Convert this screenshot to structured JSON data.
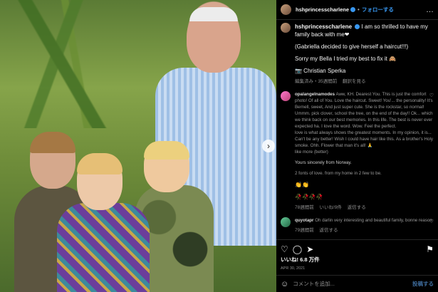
{
  "header": {
    "username": "hshprincesscharlene",
    "separator": "•",
    "follow_label": "フォローする",
    "more": "…"
  },
  "caption": {
    "username": "hshprincesscharlene",
    "line1": "I am so thrilled to have my family back with me❤",
    "line2": "(Gabriella decided to give herself a haircut!!!)",
    "line3": "Sorry my Bella I tried my best to fix it 🙈",
    "credit": "📷 Christian Sperka",
    "meta_time": "編集済み・35週間前",
    "meta_translate": "翻訳を見る"
  },
  "comments": [
    {
      "username": "opalangelnamodes",
      "text": "Aww, KH. Dearest You. This is just the comfort photo! Of all of You. Love the haircut. Sweet! You'... the personality! It's Bernell, sweet, And just super cute. She is the rockstar, so normal! Ummm. pick clover, school the tree, on the end of the day!! Ok... which we think back on our best memories. In this life. The best is never ever expected ha. I love the word. Wow. Feel the perfect.",
      "text2": "love is what always shows the greatest moments. In my opinion, it is... Can't be any better! Wish I could have hair like this. As a brother's Holy smoke. Ohh. Flower that man it's all! 🙏",
      "faint": "like more (better)",
      "para2": "Yours sincerely from Norway.",
      "para3": "2 fonts of love. from my home in 2 few to be.",
      "emoji1": "👏👏",
      "emoji2": "🥀🥀🥀🥀",
      "meta": [
        "78週間前",
        "いいね!9件",
        "返信する"
      ]
    },
    {
      "username": "quyotapr",
      "text": "Oh darlin very interesting and beautiful family, bonne reason",
      "meta": [
        "79週間前",
        "返信する"
      ]
    }
  ],
  "actions": {
    "like": "♡",
    "comment": "◯",
    "share": "➤",
    "bookmark": "⚑"
  },
  "likes": "いいね! 6.8 万件",
  "date": "APR 30, 2021",
  "add_comment": {
    "emoji": "☺",
    "placeholder": "コメントを追加...",
    "post": "投稿する"
  }
}
